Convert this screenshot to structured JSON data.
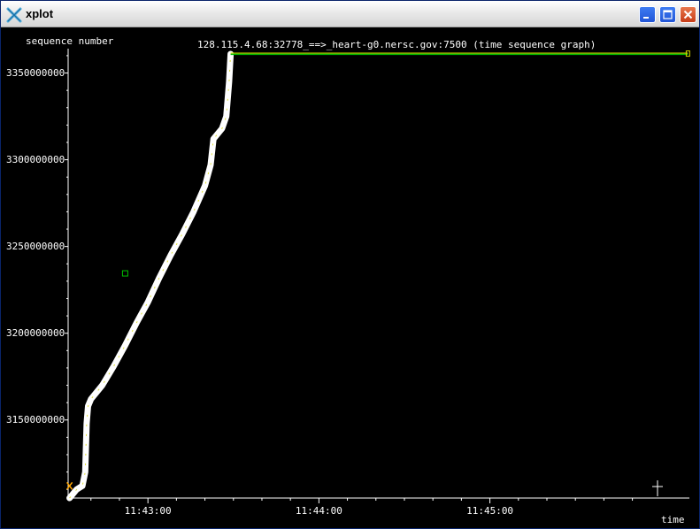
{
  "window": {
    "title": "xplot",
    "app_icon": "xplot-x-icon",
    "buttons": {
      "minimize": "minimize-icon",
      "maximize": "maximize-icon",
      "close": "close-icon"
    }
  },
  "chart_data": {
    "type": "line",
    "title": "128.115.4.68:32778_==>_heart-g0.nersc.gov:7500 (time sequence graph)",
    "xlabel": "time",
    "ylabel": "sequence number",
    "x_tick_labels": [
      "11:43:00",
      "11:44:00",
      "11:45:00"
    ],
    "x_tick_seconds": [
      0,
      60,
      120
    ],
    "y_tick_values": [
      3150000000,
      3200000000,
      3250000000,
      3300000000,
      3350000000
    ],
    "y_tick_labels": [
      "3150000000",
      "3200000000",
      "3250000000",
      "3300000000",
      "3350000000"
    ],
    "xlim_seconds": [
      -28,
      190
    ],
    "ylim": [
      3105000000,
      3362000000
    ],
    "grid": false,
    "colors": {
      "background": "#000000",
      "data": "#ffffff",
      "ack": "#00c000",
      "window": "#d8d800",
      "marker": "#ffa500"
    },
    "series": [
      {
        "x": [
          -27.5,
          -25,
          -23,
          -22,
          -21.5,
          -21,
          -20,
          -16,
          -12,
          -8,
          -4,
          0,
          4,
          8,
          12,
          16,
          20,
          22,
          23,
          26,
          27.5,
          28.5,
          29
        ],
        "y": [
          3105000000,
          3110000000,
          3112000000,
          3120000000,
          3148000000,
          3158000000,
          3162000000,
          3170000000,
          3181000000,
          3193000000,
          3206000000,
          3218000000,
          3232000000,
          3245000000,
          3257000000,
          3270000000,
          3285000000,
          3297000000,
          3312000000,
          3318000000,
          3325000000,
          3345000000,
          3361000000
        ]
      },
      {
        "x": [
          29,
          189.5
        ],
        "y": [
          3361500000,
          3361500000
        ]
      },
      {
        "x": [
          29,
          189.5
        ],
        "y": [
          3360800000,
          3360800000
        ]
      }
    ]
  }
}
